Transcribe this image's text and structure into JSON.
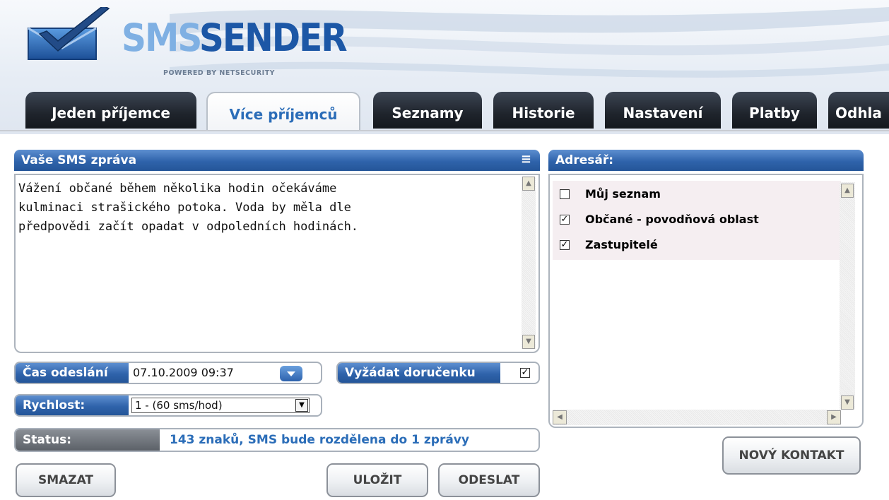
{
  "app": {
    "logo_sms": "SMS",
    "logo_sender": "SENDER",
    "logo_sub": "POWERED BY NETSECURITY"
  },
  "tabs": [
    {
      "label": "Jeden příjemce",
      "active": false
    },
    {
      "label": "Více příjemců",
      "active": true
    },
    {
      "label": "Seznamy",
      "active": false
    },
    {
      "label": "Historie",
      "active": false
    },
    {
      "label": "Nastavení",
      "active": false
    },
    {
      "label": "Platby",
      "active": false
    },
    {
      "label": "Odhla",
      "active": false
    }
  ],
  "sms_panel": {
    "title": "Vaše SMS zpráva",
    "message": "Vážení občané během několika hodin očekáváme\nkulminaci strašického potoka. Voda by měla dle\npředpovědi začít opadat v odpoledních hodinách."
  },
  "send_time": {
    "label": "Čas odeslání",
    "value": "07.10.2009  09:37"
  },
  "delivery": {
    "label": "Vyžádat doručenku",
    "checked": true
  },
  "speed": {
    "label": "Rychlost:",
    "selected": "1 - (60 sms/hod)"
  },
  "status": {
    "label": "Status:",
    "text": "143 znaků, SMS bude rozdělena do 1 zprávy"
  },
  "buttons": {
    "delete": "SMAZAT",
    "save": "ULOŽIT",
    "send": "ODESLAT",
    "new_contact": "NOVÝ KONTAKT"
  },
  "address_book": {
    "title": "Adresář:",
    "items": [
      {
        "label": "Můj seznam",
        "checked": false
      },
      {
        "label": "Občané - povodňová oblast",
        "checked": true
      },
      {
        "label": "Zastupitelé",
        "checked": true
      }
    ]
  },
  "colors": {
    "accent": "#2f63ab",
    "tab_dark": "#1f242c",
    "status_text": "#2b6db8"
  }
}
